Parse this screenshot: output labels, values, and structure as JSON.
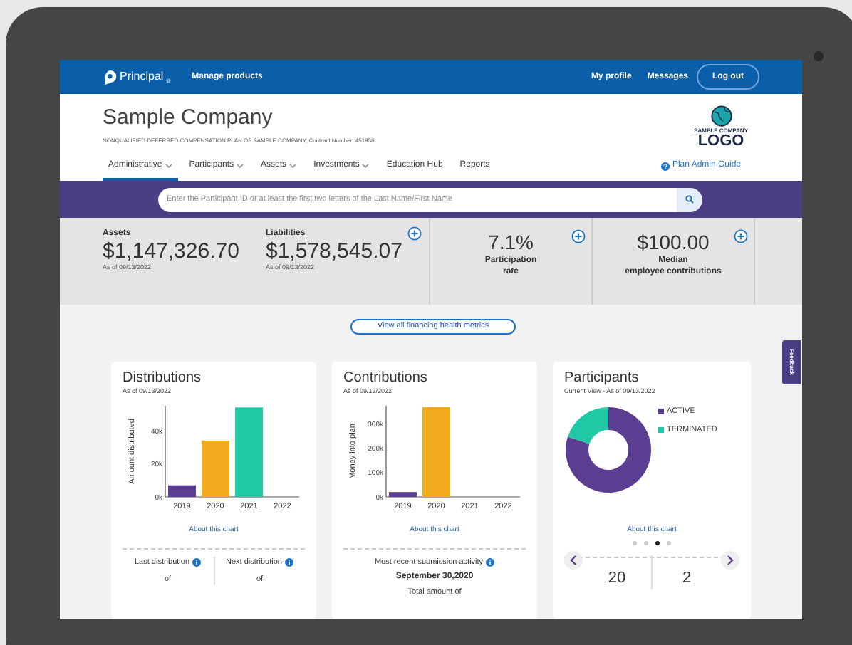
{
  "top_bar": {
    "brand": "Principal",
    "brand_mark": "®",
    "nav": [
      {
        "label": "Manage products"
      }
    ],
    "right_links": [
      {
        "label": "My profile"
      },
      {
        "label": "Messages"
      }
    ],
    "logout": "Log out"
  },
  "header": {
    "title": "Sample Company",
    "subtitle": "NONQUALIFIED DEFERRED COMPENSATION PLAN OF SAMPLE COMPANY, Contract Number: 451958",
    "logo_small": "SAMPLE COMPANY",
    "logo_text": "LOGO"
  },
  "tabs": [
    {
      "label": "Administrative",
      "dropdown": true,
      "selected": true
    },
    {
      "label": "Participants",
      "dropdown": true,
      "selected": false
    },
    {
      "label": "Assets",
      "dropdown": true,
      "selected": false
    },
    {
      "label": "Investments",
      "dropdown": true,
      "selected": false
    },
    {
      "label": "Education Hub",
      "dropdown": false,
      "selected": false
    },
    {
      "label": "Reports",
      "dropdown": false,
      "selected": false
    }
  ],
  "help_link": "Plan Admin Guide",
  "search": {
    "placeholder": "Enter the Participant ID or at least the first two letters of the Last Name/First Name"
  },
  "metrics": {
    "money": [
      {
        "label": "Assets",
        "value": "$1,147,326.70",
        "date": "As of 09/13/2022",
        "expandable": false
      },
      {
        "label": "Liabilities",
        "value": "$1,578,545.07",
        "date": "As of 09/13/2022",
        "expandable": true
      }
    ],
    "rates": [
      {
        "value": "7.1%",
        "label_lines": [
          "Participation",
          "rate"
        ]
      },
      {
        "value": "$100.00",
        "label_lines": [
          "Median",
          "employee contributions"
        ]
      }
    ]
  },
  "metrics_button": "View all financing health metrics",
  "feedback": "Feedback",
  "cards": [
    {
      "kind": "bar",
      "title": "Distributions",
      "date": "As of 09/13/2022",
      "link": "About this chart",
      "bars": [
        {
          "color": "#5b3e91"
        },
        {
          "color": "#f2ab1c"
        },
        {
          "color": "#20c9a6"
        }
      ],
      "chart_data": {
        "type": "bar",
        "ylabel": "Amount distributed",
        "categories": [
          "2019",
          "2020",
          "2021",
          "2022"
        ],
        "ylim": [
          0,
          55000
        ],
        "yticks": [
          {
            "value": 0,
            "label": "0k"
          },
          {
            "value": 20000,
            "label": "20k"
          },
          {
            "value": 40000,
            "label": "40k"
          }
        ],
        "values": [
          7000,
          34000,
          54000,
          null
        ]
      },
      "footer_cols": [
        {
          "label": "Last distribution",
          "sub": "of"
        },
        {
          "label": "Next distribution",
          "sub": "of"
        }
      ]
    },
    {
      "kind": "bar",
      "title": "Contributions",
      "date": "As of 09/13/2022",
      "link": "About this chart",
      "bars": [
        {
          "color": "#5b3e91"
        },
        {
          "color": "#f2ab1c"
        }
      ],
      "chart_data": {
        "type": "bar",
        "ylabel": "Money into plan",
        "categories": [
          "2019",
          "2020",
          "2021",
          "2022"
        ],
        "ylim": [
          0,
          375000
        ],
        "yticks": [
          {
            "value": 0,
            "label": "0k"
          },
          {
            "value": 100000,
            "label": "100k"
          },
          {
            "value": 200000,
            "label": "200k"
          },
          {
            "value": 300000,
            "label": "300k"
          }
        ],
        "values": [
          20000,
          370000,
          null,
          null
        ]
      },
      "footer_lines": [
        {
          "text": "Most recent submission activity",
          "info": true,
          "bold": false
        },
        {
          "text": "September 30,2020",
          "info": false,
          "bold": true
        },
        {
          "text": "Total amount of",
          "info": false,
          "bold": false
        }
      ]
    },
    {
      "kind": "donut",
      "title": "Participants",
      "date": "Current View - As of 09/13/2022",
      "link": "About this chart",
      "legend": [
        {
          "label": "ACTIVE",
          "color": "#5b3e91"
        },
        {
          "label": "TERMINATED",
          "color": "#20c9a6"
        }
      ],
      "pager": [
        {
          "selected": false
        },
        {
          "selected": false
        },
        {
          "selected": true
        },
        {
          "selected": false
        }
      ],
      "counts": [
        "20",
        "2"
      ]
    }
  ]
}
